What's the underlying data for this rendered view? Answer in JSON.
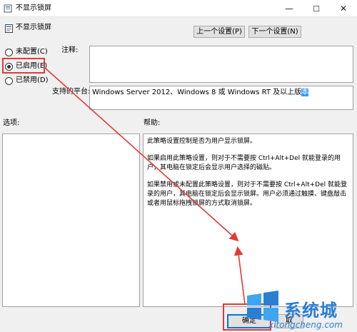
{
  "window": {
    "title": "不显示锁屏",
    "minimize": "—",
    "maximize": "☐",
    "close": "✕"
  },
  "header": {
    "title": "不显示锁屏"
  },
  "nav": {
    "prev_label": "上一个设置(P)",
    "next_label": "下一个设置(N)"
  },
  "radios": [
    {
      "label": "未配置(C)",
      "checked": false
    },
    {
      "label": "已启用(E)",
      "checked": true
    },
    {
      "label": "已禁用(D)",
      "checked": false
    }
  ],
  "comment": {
    "label": "注释:",
    "value": ""
  },
  "platform": {
    "label": "支持的平台:",
    "value_prefix": "Windows Server 2012、Windows 8 或 Windows RT 及以上版",
    "value_highlight": "本"
  },
  "options": {
    "label": "选项:"
  },
  "help": {
    "label": "帮助:",
    "paragraphs": [
      "此策略设置控制是否为用户显示锁屏。",
      "如果启用此策略设置，则对于不需要按 Ctrl+Alt+Del 就能登录的用户，其电脑在锁定后会显示用户选择的磁贴。",
      "如果禁用或未配置此策略设置，则对于不需要按 Ctrl+Alt+Del 就能登录的用户，其电脑在锁定后会显示锁屏。用户必须通过触摸、键盘敲击或者用鼠标拖拽锁屏的方式取消锁屏。"
    ]
  },
  "footer": {
    "ok_label": "确定",
    "cancel_label": "取"
  },
  "watermark": {
    "brand": "系统城",
    "url": "xitongcheng.com"
  },
  "colors": {
    "annotation_red": "#e23a3a",
    "selection_blue": "#3399ff",
    "brand_blue": "#2a7fd4"
  }
}
